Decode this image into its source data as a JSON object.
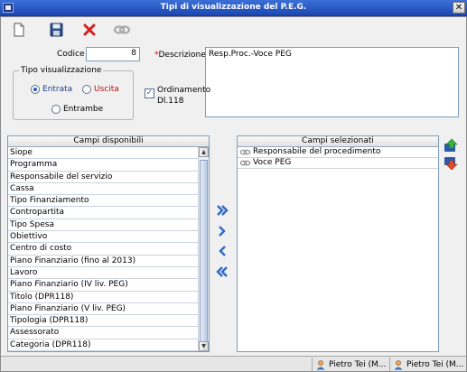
{
  "window": {
    "title": "Tipi di visualizzazione del P.E.G."
  },
  "toolbar": {
    "new_icon": "new-document-icon",
    "save_icon": "save-icon",
    "delete_icon": "delete-icon",
    "link_icon": "link-icon"
  },
  "form": {
    "codice_label": "Codice",
    "codice_value": "8",
    "descrizione_required_mark": "*",
    "descrizione_label": "Descrizione",
    "descrizione_value": "Resp.Proc.-Voce PEG",
    "tipo_label": "Tipo visualizzazione",
    "entrata_label": "Entrata",
    "uscita_label": "Uscita",
    "entrambe_label": "Entrambe",
    "selected_tipo": "Entrata",
    "ordinamento_label_1": "Ordinamento",
    "ordinamento_label_2": "Dl.118",
    "ordinamento_checked": true
  },
  "available": {
    "header": "Campi disponibili",
    "items": [
      "Siope",
      "Programma",
      "Responsabile del servizio",
      "Cassa",
      "Tipo Finanziamento",
      "Contropartita",
      "Tipo Spesa",
      "Obiettivo",
      "Centro di costo",
      "Piano Finanziario (fino al 2013)",
      "Lavoro",
      "Piano Finanziario (IV liv. PEG)",
      "Titolo (DPR118)",
      "Piano Finanziario (V liv. PEG)",
      "Tipologia (DPR118)",
      "Assessorato",
      "Categoria (DPR118)"
    ]
  },
  "selected": {
    "header": "Campi selezionati",
    "items": [
      "Responsabile del procedimento",
      "Voce PEG"
    ]
  },
  "status": {
    "users": [
      "Pietro Tei (M...",
      "Pietro Tei (M..."
    ]
  },
  "colors": {
    "title_bar": "#1c47b3",
    "accent_blue": "#1f58c7",
    "uscita_red": "#b0120d"
  }
}
